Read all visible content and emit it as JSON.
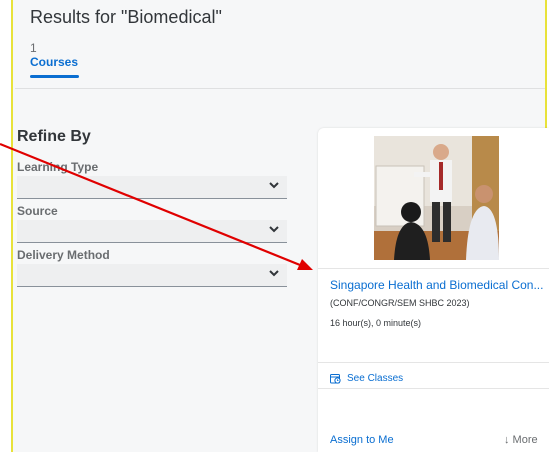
{
  "header": {
    "title": "Results for \"Biomedical\"",
    "tab_count": "1",
    "tab_label": "Courses"
  },
  "refine": {
    "title": "Refine By",
    "filters": [
      {
        "label": "Learning Type",
        "value": ""
      },
      {
        "label": "Source",
        "value": ""
      },
      {
        "label": "Delivery Method",
        "value": ""
      }
    ]
  },
  "card": {
    "title": "Singapore Health and Biomedical Con...",
    "code": "(CONF/CONGR/SEM SHBC 2023)",
    "duration": "16 hour(s), 0 minute(s)",
    "see_classes": "See Classes",
    "assign": "Assign to Me",
    "more": "↓ More"
  },
  "colors": {
    "accent": "#0a6ed1",
    "border_highlight": "#e8e23a",
    "annotation_arrow": "#e00000"
  }
}
